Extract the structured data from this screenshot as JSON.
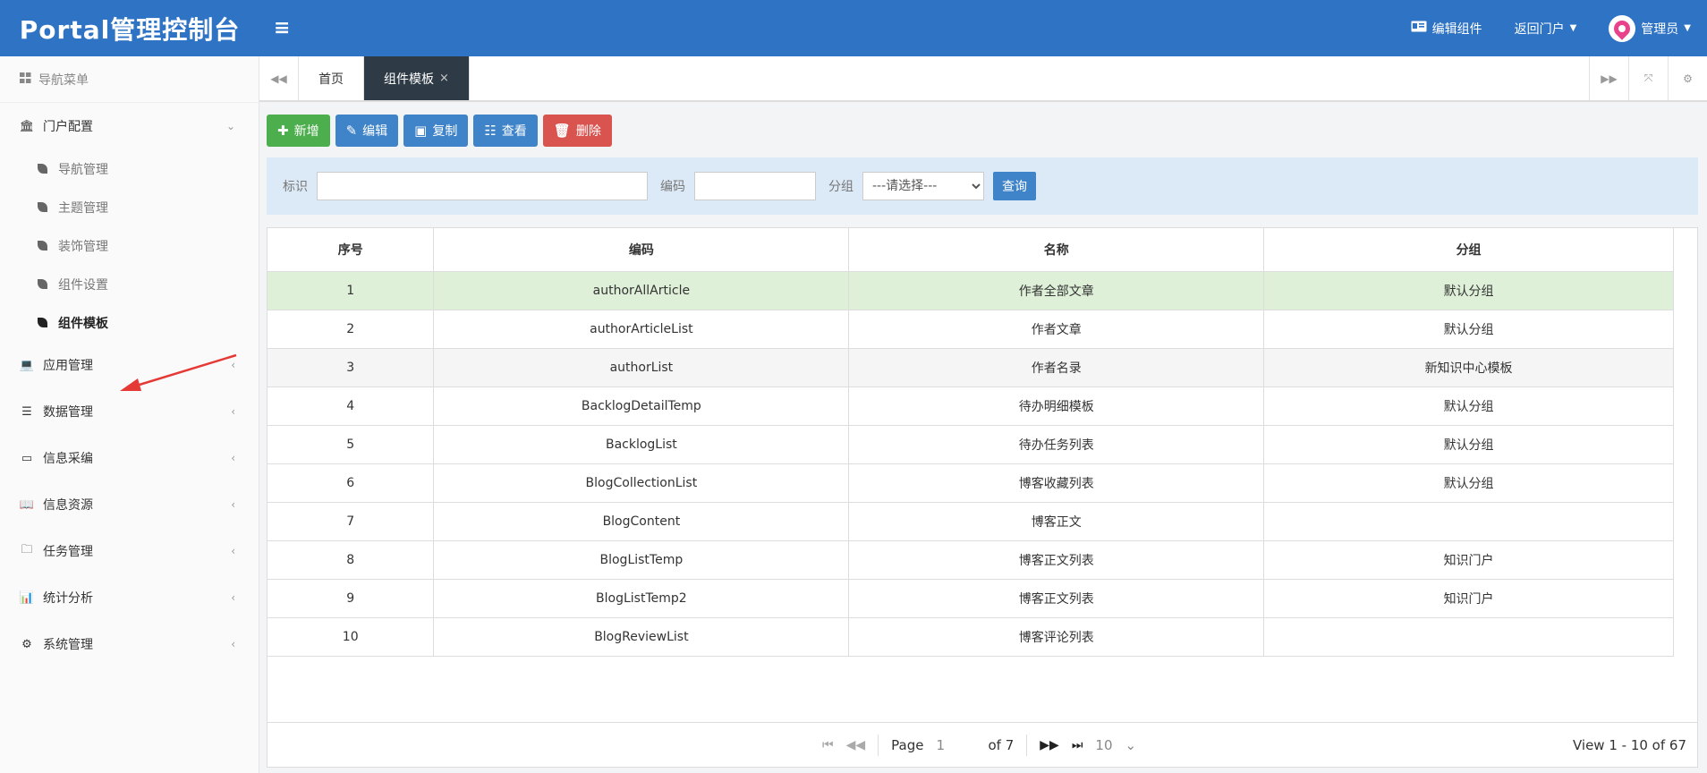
{
  "header": {
    "brand": "Portal管理控制台",
    "menu_toggle": "≡",
    "edit_component": "编辑组件",
    "return_portal": "返回门户",
    "user": "管理员"
  },
  "sidebar": {
    "title": "导航菜单",
    "groups": [
      {
        "label": "门户配置",
        "icon": "bank-icon"
      },
      {
        "label": "应用管理",
        "icon": "laptop-icon"
      },
      {
        "label": "数据管理",
        "icon": "list-icon"
      },
      {
        "label": "信息采编",
        "icon": "card-icon"
      },
      {
        "label": "信息资源",
        "icon": "book-icon"
      },
      {
        "label": "任务管理",
        "icon": "folder-icon"
      },
      {
        "label": "统计分析",
        "icon": "chart-icon"
      },
      {
        "label": "系统管理",
        "icon": "gears-icon"
      }
    ],
    "sub_items": [
      "导航管理",
      "主题管理",
      "装饰管理",
      "组件设置",
      "组件模板"
    ]
  },
  "tabs": {
    "home": "首页",
    "active": "组件模板",
    "close": "×"
  },
  "toolbar": {
    "add": "新增",
    "edit": "编辑",
    "copy": "复制",
    "view": "查看",
    "delete": "删除"
  },
  "search": {
    "id_label": "标识",
    "code_label": "编码",
    "group_label": "分组",
    "group_selected": "---请选择---",
    "query": "查询"
  },
  "table": {
    "headers": [
      "序号",
      "编码",
      "名称",
      "分组"
    ],
    "rows": [
      [
        "1",
        "authorAllArticle",
        "作者全部文章",
        "默认分组"
      ],
      [
        "2",
        "authorArticleList",
        "作者文章",
        "默认分组"
      ],
      [
        "3",
        "authorList",
        "作者名录",
        "新知识中心模板"
      ],
      [
        "4",
        "BacklogDetailTemp",
        "待办明细模板",
        "默认分组"
      ],
      [
        "5",
        "BacklogList",
        "待办任务列表",
        "默认分组"
      ],
      [
        "6",
        "BlogCollectionList",
        "博客收藏列表",
        "默认分组"
      ],
      [
        "7",
        "BlogContent",
        "博客正文",
        ""
      ],
      [
        "8",
        "BlogListTemp",
        "博客正文列表",
        "知识门户"
      ],
      [
        "9",
        "BlogListTemp2",
        "博客正文列表",
        "知识门户"
      ],
      [
        "10",
        "BlogReviewList",
        "博客评论列表",
        ""
      ]
    ]
  },
  "pager": {
    "page_label": "Page",
    "page_value": "1",
    "of_total": "of 7",
    "page_size": "10",
    "summary": "View 1 - 10 of 67"
  },
  "colors": {
    "topbar": "#2f73c4",
    "selected_row": "#dff0d8",
    "arrow": "#e53935"
  }
}
